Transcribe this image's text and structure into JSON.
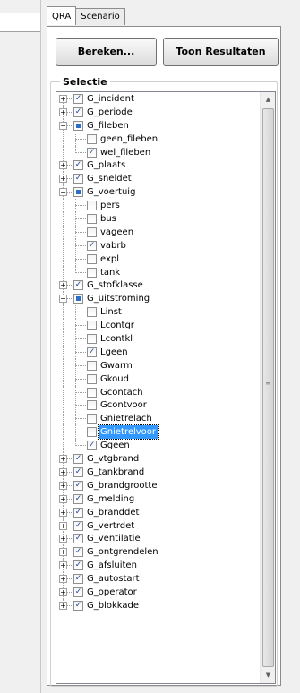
{
  "tabs": [
    {
      "label": "QRA",
      "active": true
    },
    {
      "label": "Scenario",
      "active": false
    }
  ],
  "buttons": {
    "bereken": "Bereken...",
    "toon": "Toon Resultaten"
  },
  "selectie": {
    "title": "Selectie",
    "nodes": [
      {
        "label": "G_incident",
        "level": 0,
        "expander": "+",
        "state": "checked"
      },
      {
        "label": "G_periode",
        "level": 0,
        "expander": "+",
        "state": "checked"
      },
      {
        "label": "G_fileben",
        "level": 0,
        "expander": "-",
        "state": "partial"
      },
      {
        "label": "geen_fileben",
        "level": 1,
        "state": "unchecked"
      },
      {
        "label": "wel_fileben",
        "level": 1,
        "state": "checked"
      },
      {
        "label": "G_plaats",
        "level": 0,
        "expander": "+",
        "state": "checked"
      },
      {
        "label": "G_sneldet",
        "level": 0,
        "expander": "+",
        "state": "checked"
      },
      {
        "label": "G_voertuig",
        "level": 0,
        "expander": "-",
        "state": "partial"
      },
      {
        "label": "pers",
        "level": 1,
        "state": "unchecked"
      },
      {
        "label": "bus",
        "level": 1,
        "state": "unchecked"
      },
      {
        "label": "vageen",
        "level": 1,
        "state": "unchecked"
      },
      {
        "label": "vabrb",
        "level": 1,
        "state": "checked"
      },
      {
        "label": "expl",
        "level": 1,
        "state": "unchecked"
      },
      {
        "label": "tank",
        "level": 1,
        "state": "unchecked"
      },
      {
        "label": "G_stofklasse",
        "level": 0,
        "expander": "+",
        "state": "checked"
      },
      {
        "label": "G_uitstroming",
        "level": 0,
        "expander": "-",
        "state": "partial"
      },
      {
        "label": "Linst",
        "level": 1,
        "state": "unchecked"
      },
      {
        "label": "Lcontgr",
        "level": 1,
        "state": "unchecked"
      },
      {
        "label": "Lcontkl",
        "level": 1,
        "state": "unchecked"
      },
      {
        "label": "Lgeen",
        "level": 1,
        "state": "checked"
      },
      {
        "label": "Gwarm",
        "level": 1,
        "state": "unchecked"
      },
      {
        "label": "Gkoud",
        "level": 1,
        "state": "unchecked"
      },
      {
        "label": "Gcontach",
        "level": 1,
        "state": "unchecked"
      },
      {
        "label": "Gcontvoor",
        "level": 1,
        "state": "unchecked"
      },
      {
        "label": "Gnietrelach",
        "level": 1,
        "state": "unchecked"
      },
      {
        "label": "Gnietrelvoor",
        "level": 1,
        "state": "unchecked",
        "selected": true
      },
      {
        "label": "Ggeen",
        "level": 1,
        "state": "checked"
      },
      {
        "label": "G_vtgbrand",
        "level": 0,
        "expander": "+",
        "state": "checked"
      },
      {
        "label": "G_tankbrand",
        "level": 0,
        "expander": "+",
        "state": "checked"
      },
      {
        "label": "G_brandgrootte",
        "level": 0,
        "expander": "+",
        "state": "checked"
      },
      {
        "label": "G_melding",
        "level": 0,
        "expander": "+",
        "state": "checked"
      },
      {
        "label": "G_branddet",
        "level": 0,
        "expander": "+",
        "state": "checked"
      },
      {
        "label": "G_vertrdet",
        "level": 0,
        "expander": "+",
        "state": "checked"
      },
      {
        "label": "G_ventilatie",
        "level": 0,
        "expander": "+",
        "state": "checked"
      },
      {
        "label": "G_ontgrendelen",
        "level": 0,
        "expander": "+",
        "state": "checked"
      },
      {
        "label": "G_afsluiten",
        "level": 0,
        "expander": "+",
        "state": "checked"
      },
      {
        "label": "G_autostart",
        "level": 0,
        "expander": "+",
        "state": "checked"
      },
      {
        "label": "G_operator",
        "level": 0,
        "expander": "+",
        "state": "checked"
      },
      {
        "label": "G_blokkade",
        "level": 0,
        "expander": "+",
        "state": "checked"
      }
    ]
  },
  "icons": {
    "scroll_up": "scroll-up-arrow-icon",
    "scroll_down": "scroll-down-arrow-icon",
    "expand": "plus-icon",
    "collapse": "minus-icon",
    "checkmark": "checkmark-icon"
  },
  "colors": {
    "selection": "#3399ff",
    "check": "#21449c",
    "partial": "#2d6ec7"
  }
}
